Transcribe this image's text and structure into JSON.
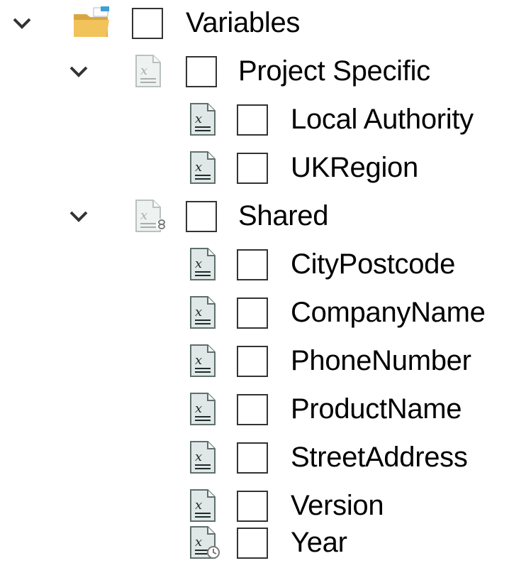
{
  "tree": {
    "root": {
      "label": "Variables",
      "icon": "folder-icon",
      "expanded": true
    },
    "groups": [
      {
        "label": "Project Specific",
        "icon": "variable-group-icon",
        "expanded": true,
        "items": [
          {
            "label": "Local Authority",
            "icon": "variable-icon"
          },
          {
            "label": "UKRegion",
            "icon": "variable-icon"
          }
        ]
      },
      {
        "label": "Shared",
        "icon": "shared-variable-group-icon",
        "expanded": true,
        "items": [
          {
            "label": "CityPostcode",
            "icon": "variable-icon"
          },
          {
            "label": "CompanyName",
            "icon": "variable-icon"
          },
          {
            "label": "PhoneNumber",
            "icon": "variable-icon"
          },
          {
            "label": "ProductName",
            "icon": "variable-icon"
          },
          {
            "label": "StreetAddress",
            "icon": "variable-icon"
          },
          {
            "label": "Version",
            "icon": "variable-icon"
          },
          {
            "label": "Year",
            "icon": "date-variable-icon"
          }
        ]
      }
    ]
  },
  "colors": {
    "folder": "#f2c35a",
    "folder_accent": "#3f9fd8",
    "chevron": "#333333",
    "checkbox_border": "#333333",
    "icon_doc": "#dfe8e6",
    "icon_doc_border": "#5f6f6c"
  }
}
